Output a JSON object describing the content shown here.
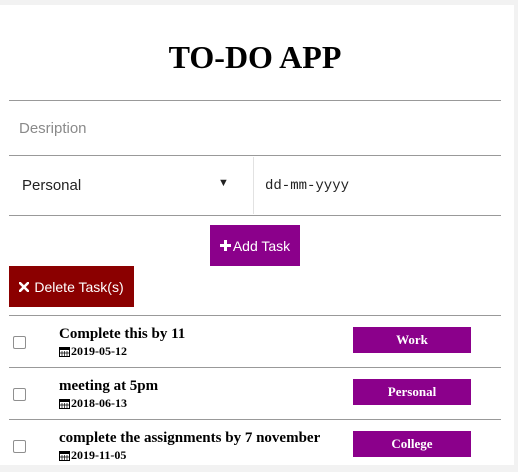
{
  "app": {
    "title": "TO-DO APP"
  },
  "form": {
    "description_placeholder": "Desription",
    "description_value": "",
    "category_selected": "Personal",
    "date_placeholder": "dd-mm-yyyy",
    "add_label": "Add Task",
    "delete_label": "Delete Task(s)"
  },
  "icons": {
    "add": "plus-icon",
    "delete": "times-icon",
    "date": "calendar-icon",
    "select": "caret-down-icon"
  },
  "colors": {
    "primary": "#8b008b",
    "danger": "#8b0000"
  },
  "tasks": [
    {
      "text": "Complete this by 11",
      "date": "2019-05-12",
      "category": "Work",
      "checked": false
    },
    {
      "text": "meeting at 5pm",
      "date": "2018-06-13",
      "category": "Personal",
      "checked": false
    },
    {
      "text": "complete the assignments by 7 november",
      "date": "2019-11-05",
      "category": "College",
      "checked": false
    }
  ]
}
